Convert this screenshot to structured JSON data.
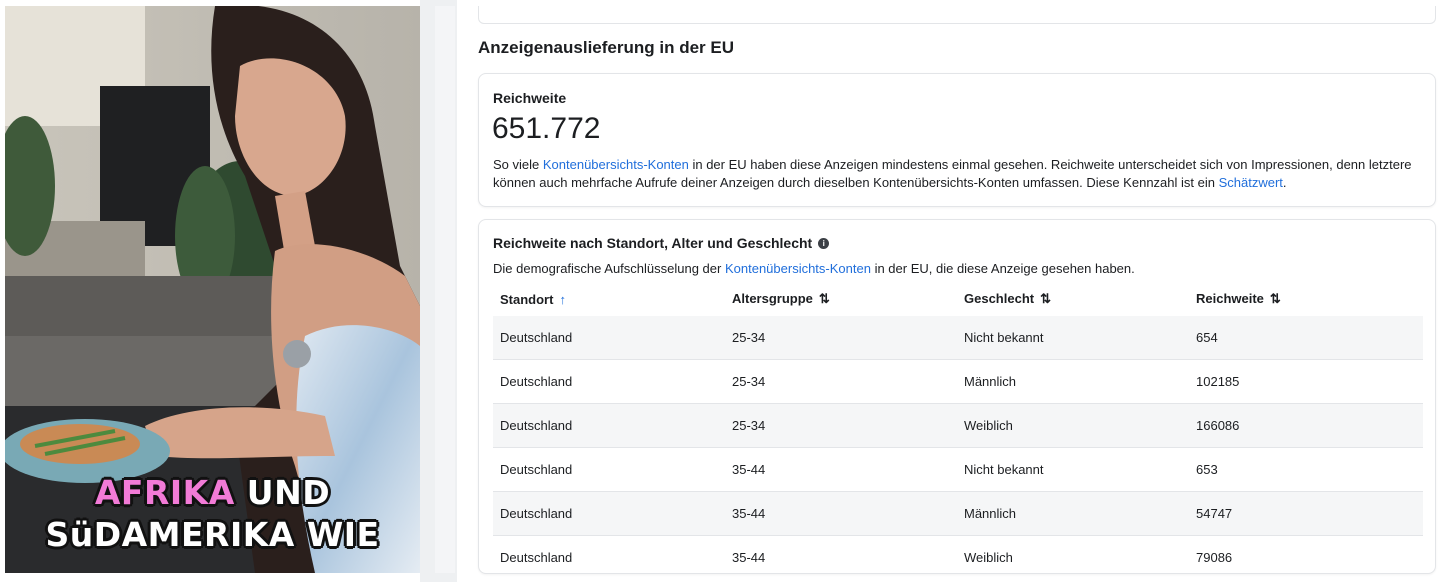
{
  "video": {
    "caption_line1_a": "AFRIKA",
    "caption_line1_b": "UND",
    "caption_line2": "SüDAMERIKA WIE"
  },
  "section": {
    "title": "Anzeigenauslieferung in der EU"
  },
  "reach_card": {
    "title": "Reichweite",
    "value": "651.772",
    "desc_part1": "So viele ",
    "desc_link1": "Kontenübersichts-Konten",
    "desc_part2": " in der EU haben diese Anzeigen mindestens einmal gesehen. Reichweite unterscheidet sich von Impressionen, denn letztere können auch mehrfache Aufrufe deiner Anzeigen durch dieselben Kontenübersichts-Konten umfassen. Diese Kennzahl ist ein ",
    "desc_link2": "Schätzwert",
    "desc_part3": "."
  },
  "demo_card": {
    "title": "Reichweite nach Standort, Alter und Geschlecht",
    "info_glyph": "i",
    "desc_part1": "Die demografische Aufschlüsselung der ",
    "desc_link": "Kontenübersichts-Konten",
    "desc_part2": " in der EU, die diese Anzeige gesehen haben.",
    "columns": [
      "Standort",
      "Altersgruppe",
      "Geschlecht",
      "Reichweite"
    ],
    "sort_icons": {
      "active": "↑",
      "inactive": "⇅"
    },
    "rows": [
      [
        "Deutschland",
        "25-34",
        "Nicht bekannt",
        "654"
      ],
      [
        "Deutschland",
        "25-34",
        "Männlich",
        "102185"
      ],
      [
        "Deutschland",
        "25-34",
        "Weiblich",
        "166086"
      ],
      [
        "Deutschland",
        "35-44",
        "Nicht bekannt",
        "653"
      ],
      [
        "Deutschland",
        "35-44",
        "Männlich",
        "54747"
      ],
      [
        "Deutschland",
        "35-44",
        "Weiblich",
        "79086"
      ]
    ]
  },
  "colors": {
    "link": "#216fdb",
    "caption_accent": "#f27bd7",
    "row_shade": "#f5f6f7"
  }
}
